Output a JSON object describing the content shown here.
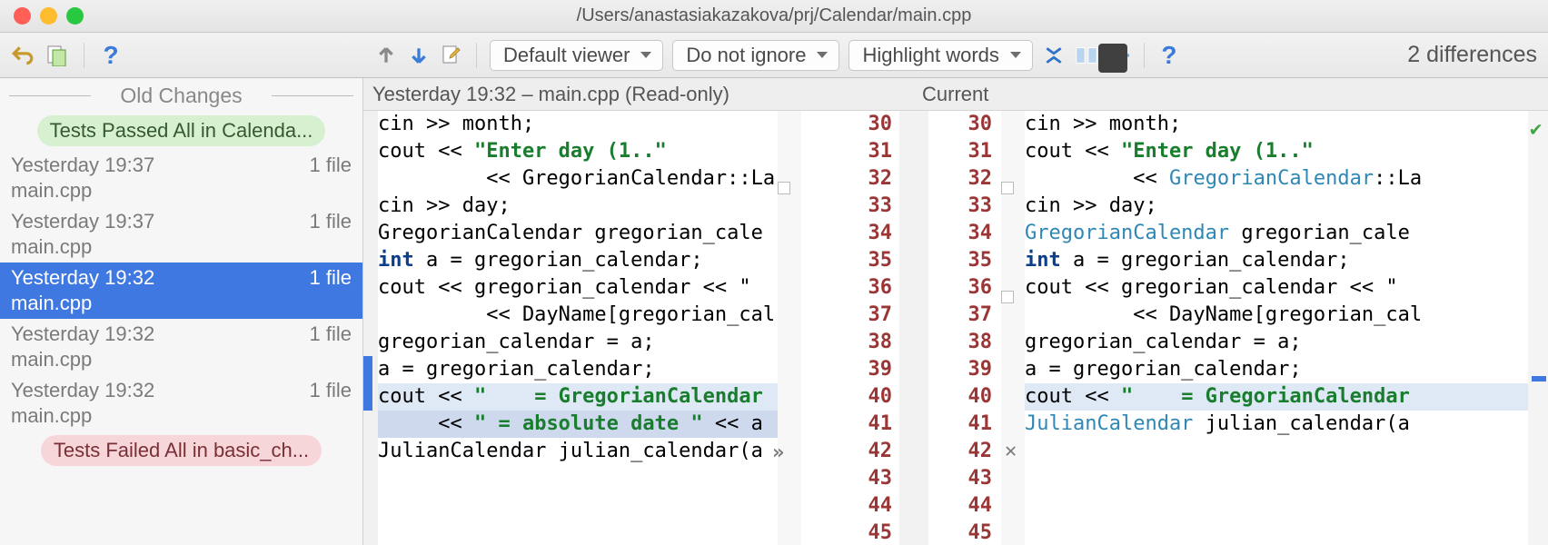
{
  "window_title": "/Users/anastasiakazakova/prj/Calendar/main.cpp",
  "dropdowns": {
    "viewer": "Default viewer",
    "ignore": "Do not ignore",
    "highlight": "Highlight words"
  },
  "diff_count": "2 differences",
  "sidebar": {
    "header": "Old Changes",
    "passed_pill": "Tests Passed All in Calenda...",
    "failed_pill": "Tests Failed All in basic_ch...",
    "items": [
      {
        "time": "Yesterday 19:37",
        "files": "1 file",
        "name": "main.cpp"
      },
      {
        "time": "Yesterday 19:37",
        "files": "1 file",
        "name": "main.cpp"
      },
      {
        "time": "Yesterday 19:32",
        "files": "1 file",
        "name": "main.cpp",
        "selected": true
      },
      {
        "time": "Yesterday 19:32",
        "files": "1 file",
        "name": "main.cpp"
      },
      {
        "time": "Yesterday 19:32",
        "files": "1 file",
        "name": "main.cpp"
      }
    ]
  },
  "pane_headers": {
    "left": "Yesterday 19:32 – main.cpp (Read-only)",
    "right": "Current"
  },
  "line_numbers": {
    "start": 30,
    "end": 45
  },
  "left_code": [
    {
      "t": "cin >> month;",
      "cls": ""
    },
    {
      "t": "cout << \"Enter day (1..\"",
      "cls": "",
      "frag": [
        [
          "",
          "cout << "
        ],
        [
          "str",
          "\"Enter day (1..\""
        ]
      ]
    },
    {
      "t": "         << GregorianCalendar::La",
      "cls": ""
    },
    {
      "t": "cin >> day;",
      "cls": ""
    },
    {
      "t": "",
      "cls": ""
    },
    {
      "t": "GregorianCalendar gregorian_cale",
      "cls": ""
    },
    {
      "t": "int a = gregorian_calendar;",
      "cls": "",
      "frag": [
        [
          "kw",
          "int"
        ],
        [
          "",
          " a = gregorian_calendar;"
        ]
      ]
    },
    {
      "t": "cout << gregorian_calendar << \" ",
      "cls": ""
    },
    {
      "t": "         << DayName[gregorian_cal",
      "cls": ""
    },
    {
      "t": "",
      "cls": ""
    },
    {
      "t": "gregorian_calendar = a;",
      "cls": ""
    },
    {
      "t": "a = gregorian_calendar;",
      "cls": ""
    },
    {
      "t": "cout << \"    = GregorianCalendar",
      "cls": "modified",
      "frag": [
        [
          "",
          "cout << "
        ],
        [
          "str",
          "\"    = GregorianCalendar"
        ]
      ]
    },
    {
      "t": "     << \" = absolute date \" << a",
      "cls": "modified2",
      "frag": [
        [
          "",
          "     << "
        ],
        [
          "str",
          "\" = absolute date \""
        ],
        [
          "",
          " << a"
        ]
      ]
    },
    {
      "t": "",
      "cls": ""
    },
    {
      "t": "JulianCalendar julian_calendar(a",
      "cls": ""
    }
  ],
  "right_code": [
    {
      "t": "cin >> month;",
      "cls": ""
    },
    {
      "t": "cout << \"Enter day (1..\"",
      "cls": "",
      "frag": [
        [
          "",
          "cout << "
        ],
        [
          "str",
          "\"Enter day (1..\""
        ]
      ]
    },
    {
      "t": "         << GregorianCalendar::La",
      "cls": "",
      "frag": [
        [
          "",
          "         << "
        ],
        [
          "type",
          "GregorianCalendar"
        ],
        [
          "",
          "::La"
        ]
      ]
    },
    {
      "t": "cin >> day;",
      "cls": ""
    },
    {
      "t": "",
      "cls": ""
    },
    {
      "t": "GregorianCalendar gregorian_cale",
      "cls": "",
      "frag": [
        [
          "type",
          "GregorianCalendar"
        ],
        [
          "",
          " gregorian_cale"
        ]
      ]
    },
    {
      "t": "int a = gregorian_calendar;",
      "cls": "",
      "frag": [
        [
          "kw",
          "int"
        ],
        [
          "",
          " a = gregorian_calendar;"
        ]
      ]
    },
    {
      "t": "cout << gregorian_calendar << \" ",
      "cls": ""
    },
    {
      "t": "         << DayName[gregorian_cal",
      "cls": ""
    },
    {
      "t": "",
      "cls": ""
    },
    {
      "t": "gregorian_calendar = a;",
      "cls": ""
    },
    {
      "t": "a = gregorian_calendar;",
      "cls": ""
    },
    {
      "t": "cout << \"    = GregorianCalendar",
      "cls": "modified",
      "frag": [
        [
          "",
          "cout << "
        ],
        [
          "str",
          "\"    = GregorianCalendar"
        ]
      ]
    },
    {
      "t": "",
      "cls": ""
    },
    {
      "t": "JulianCalendar julian_calendar(a",
      "cls": "",
      "frag": [
        [
          "type",
          "JulianCalendar"
        ],
        [
          "",
          " julian_calendar(a"
        ]
      ]
    },
    {
      "t": "",
      "cls": ""
    }
  ]
}
